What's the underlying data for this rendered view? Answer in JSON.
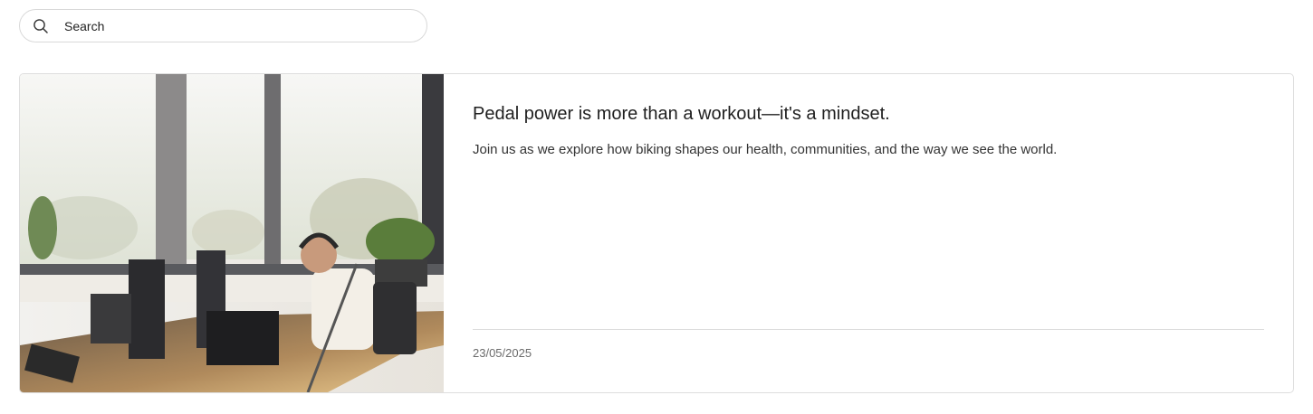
{
  "search": {
    "placeholder": "Search",
    "icon": "search-icon"
  },
  "article": {
    "image_description_icon": "photo",
    "title": "Pedal power is more than a workout—it's a mindset.",
    "excerpt": "Join us as we explore how biking shapes our health, communities, and the way we see the world.",
    "date": "23/05/2025"
  }
}
